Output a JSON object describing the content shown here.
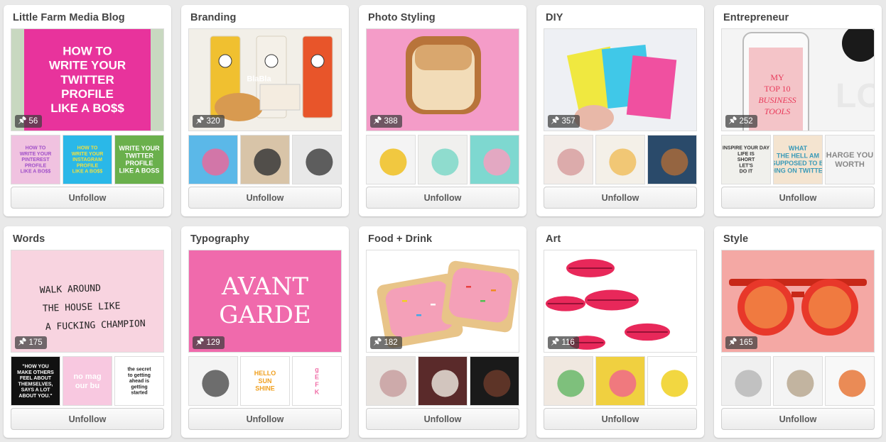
{
  "unfollow_label": "Unfollow",
  "boards": [
    {
      "title": "Little Farm Media Blog",
      "pin_count": "56",
      "cover": {
        "bg": "#f4f4f4",
        "accent": "#e8339c",
        "icon": "text-graphic",
        "text_lines": [
          "HOW TO",
          "WRITE YOUR",
          "TWITTER",
          "PROFILE",
          "LIKE A BO$$"
        ],
        "text_color": "#ffffff"
      },
      "thumbs": [
        {
          "bg": "#f0c2e0",
          "accent": "#a050c8",
          "text_lines": [
            "HOW TO",
            "WRITE YOUR",
            "PINTEREST",
            "PROFILE",
            "LIKE A BO$$"
          ]
        },
        {
          "bg": "#2ab8e8",
          "accent": "#f0e040",
          "text_lines": [
            "HOW TO",
            "WRITE YOUR",
            "INSTAGRAM",
            "PROFILE",
            "LIKE A BO$$"
          ]
        },
        {
          "bg": "#6ab04c",
          "accent": "#ffffff",
          "text_lines": [
            "WRITE YOUR",
            "TWITTER",
            "PROFILE",
            "LIKE A BOSS"
          ]
        }
      ]
    },
    {
      "title": "Branding",
      "pin_count": "320",
      "cover": {
        "bg": "#f2efe8",
        "accent": "#e8552a",
        "icon": "packaging",
        "text_lines": [
          "BlaBla"
        ],
        "text_color": "#ffffff"
      },
      "thumbs": [
        {
          "bg": "#5bb8e8",
          "accent": "#e86a9c",
          "text_lines": []
        },
        {
          "bg": "#d8c4a8",
          "accent": "#3a3a3a",
          "text_lines": []
        },
        {
          "bg": "#e8e8e8",
          "accent": "#444444",
          "text_lines": []
        }
      ]
    },
    {
      "title": "Photo Styling",
      "pin_count": "388",
      "cover": {
        "bg": "#f49cc8",
        "accent": "#c8843c",
        "icon": "toast",
        "text_lines": [],
        "text_color": "#ffffff"
      },
      "thumbs": [
        {
          "bg": "#f4f4f4",
          "accent": "#f0c020",
          "text_lines": []
        },
        {
          "bg": "#f0f0ee",
          "accent": "#7ed8c8",
          "text_lines": []
        },
        {
          "bg": "#7ed8d0",
          "accent": "#f4a0c0",
          "text_lines": []
        }
      ]
    },
    {
      "title": "DIY",
      "pin_count": "357",
      "cover": {
        "bg": "#eef0f4",
        "accent": "#f050a0",
        "icon": "cards",
        "text_lines": [],
        "text_color": "#ffffff"
      },
      "thumbs": [
        {
          "bg": "#f2ece8",
          "accent": "#d8a0a0",
          "text_lines": []
        },
        {
          "bg": "#f4f0e8",
          "accent": "#f0c060",
          "text_lines": []
        },
        {
          "bg": "#2a4a6a",
          "accent": "#a86a3a",
          "text_lines": []
        }
      ]
    },
    {
      "title": "Entrepreneur",
      "pin_count": "252",
      "cover": {
        "bg": "#f4f4f4",
        "accent": "#f06a7a",
        "icon": "phone",
        "text_lines": [
          "MY",
          "TOP 10",
          "BUSINESS",
          "TOOLS"
        ],
        "text_color": "#e83a5a"
      },
      "thumbs": [
        {
          "bg": "#f0f0ec",
          "accent": "#333333",
          "text_lines": [
            "INSPIRE YOUR DAY",
            "LIFE IS",
            "SHORT",
            "LET'S",
            "DO IT"
          ]
        },
        {
          "bg": "#f4e4d0",
          "accent": "#3a9ab8",
          "text_lines": [
            "WHAT",
            "THE HELL AM",
            "I SUPPOSED TO BE",
            "DOING ON TWITTER?"
          ]
        },
        {
          "bg": "#f4f4f4",
          "accent": "#888888",
          "text_lines": [
            "CHARGE YOUR",
            "WORTH"
          ]
        }
      ]
    },
    {
      "title": "Words",
      "pin_count": "175",
      "cover": {
        "bg": "#f8d4e0",
        "accent": "#222222",
        "icon": "handwriting",
        "text_lines": [
          "WALK AROUND",
          "THE HOUSE LIKE",
          "A FUCKING CHAMPION"
        ],
        "text_color": "#222222"
      },
      "thumbs": [
        {
          "bg": "#111111",
          "accent": "#ffffff",
          "text_lines": [
            "\"HOW YOU",
            "MAKE OTHERS",
            "FEEL ABOUT",
            "THEMSELVES,",
            "SAYS A LOT",
            "ABOUT YOU.\""
          ]
        },
        {
          "bg": "#f8c8e0",
          "accent": "#ffffff",
          "text_lines": [
            "no mag",
            "our bu"
          ]
        },
        {
          "bg": "#ffffff",
          "accent": "#222222",
          "text_lines": [
            "the secret",
            "to getting",
            "ahead is",
            "getting",
            "started"
          ]
        }
      ]
    },
    {
      "title": "Typography",
      "pin_count": "129",
      "cover": {
        "bg": "#f06aac",
        "accent": "#ffffff",
        "icon": "lettering",
        "text_lines": [
          "AVANT",
          "GARDE"
        ],
        "text_color": "#ffffff"
      },
      "thumbs": [
        {
          "bg": "#f4f4f4",
          "accent": "#555555",
          "text_lines": []
        },
        {
          "bg": "#ffffff",
          "accent": "#f0a020",
          "text_lines": [
            "HELLO",
            "SUN",
            "SHINE"
          ]
        },
        {
          "bg": "#ffffff",
          "accent": "#f070a8",
          "text_lines": [
            "g",
            "E",
            "F",
            "K"
          ]
        }
      ]
    },
    {
      "title": "Food + Drink",
      "pin_count": "182",
      "cover": {
        "bg": "#ffffff",
        "accent": "#f4a0b8",
        "icon": "pastry",
        "text_lines": [],
        "text_color": "#ffffff"
      },
      "thumbs": [
        {
          "bg": "#e8e4e0",
          "accent": "#c8a0a0",
          "text_lines": []
        },
        {
          "bg": "#5a2a2a",
          "accent": "#e8e0d8",
          "text_lines": []
        },
        {
          "bg": "#1a1a1a",
          "accent": "#6a3a2a",
          "text_lines": []
        }
      ]
    },
    {
      "title": "Art",
      "pin_count": "116",
      "cover": {
        "bg": "#ffffff",
        "accent": "#e8285a",
        "icon": "lips",
        "text_lines": [],
        "text_color": "#ffffff"
      },
      "thumbs": [
        {
          "bg": "#f0e8e0",
          "accent": "#6ab86a",
          "text_lines": []
        },
        {
          "bg": "#f0d040",
          "accent": "#f06a8a",
          "text_lines": []
        },
        {
          "bg": "#ffffff",
          "accent": "#f0d020",
          "text_lines": []
        }
      ]
    },
    {
      "title": "Style",
      "pin_count": "165",
      "cover": {
        "bg": "#f4a8a4",
        "accent": "#e8382a",
        "icon": "sunglasses",
        "text_lines": [],
        "text_color": "#ffffff"
      },
      "thumbs": [
        {
          "bg": "#f0f0f0",
          "accent": "#b8b8b8",
          "text_lines": []
        },
        {
          "bg": "#f4f4f4",
          "accent": "#b8a890",
          "text_lines": []
        },
        {
          "bg": "#f8f8f8",
          "accent": "#e8783a",
          "text_lines": []
        }
      ]
    }
  ]
}
